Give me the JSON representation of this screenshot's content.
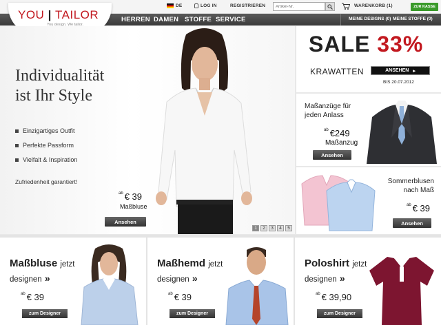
{
  "topbar": {
    "lang": "DE",
    "login": "LOG IN",
    "register": "REGISTRIEREN",
    "search_placeholder": "Artikel-Nr.",
    "cart": "WARENKORB (1)",
    "checkout": "ZUR KASSE"
  },
  "logo": {
    "left": "YOU",
    "right": "TAILOR",
    "tagline": "You design. We tailor."
  },
  "nav": {
    "items": [
      "HERREN",
      "DAMEN",
      "STOFFE",
      "SERVICE"
    ],
    "my_designs": "MEINE DESIGNS (0)",
    "my_fabrics": "MEINE STOFFE (0)"
  },
  "hero": {
    "title_line1": "Individualität",
    "title_line2": "ist Ihr Style",
    "bullets": [
      "Einzigartiges Outfit",
      "Perfekte Passform",
      "Vielfalt & Inspiration"
    ],
    "guarantee": "Zufriedenheit garantiert!",
    "price_prefix": "ab",
    "price": "€ 39",
    "product": "Maßbluse",
    "button": "Ansehen",
    "pager": [
      "1",
      "2",
      "3",
      "4",
      "5"
    ],
    "pager_active": 1
  },
  "sale": {
    "word": "SALE",
    "percent": "33%",
    "category": "KRAWATTEN",
    "button": "ANSEHEN",
    "until": "BIS 20.07.2012"
  },
  "suits": {
    "line1": "Maßanzüge für",
    "line2": "jeden Anlass",
    "price_prefix": "ab",
    "price": "€249",
    "product": "Maßanzug",
    "button": "Ansehen"
  },
  "blouses": {
    "line1": "Sommerblusen",
    "line2": "nach Maß",
    "price_prefix": "ab",
    "price": "€ 39",
    "button": "Ansehen"
  },
  "cards": [
    {
      "name": "Maßbluse",
      "jetzt": "jetzt",
      "designen": "designen",
      "arrow": "»",
      "price_prefix": "ab",
      "price": "€ 39",
      "button": "zum Designer"
    },
    {
      "name": "Maßhemd",
      "jetzt": "jetzt",
      "designen": "designen",
      "arrow": "»",
      "price_prefix": "ab",
      "price": "€ 39",
      "button": "zum Designer"
    },
    {
      "name": "Poloshirt",
      "jetzt": "jetzt",
      "designen": "designen",
      "arrow": "»",
      "price_prefix": "ab",
      "price": "€ 39,90",
      "button": "zum Designer"
    }
  ],
  "colors": {
    "brand_red": "#c2181f",
    "checkout_green": "#3a9a2a",
    "nav_dark": "#3a3a3a"
  }
}
